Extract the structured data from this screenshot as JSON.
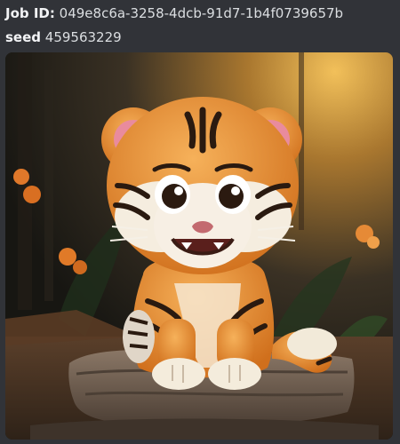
{
  "message": {
    "job_label": "Job ID:",
    "job_id": "049e8c6a-3258-4dcb-91d7-1b4f0739657b",
    "seed_label": "seed",
    "seed_value": "459563229"
  },
  "image": {
    "subject": "cartoon-tiger-cub-on-rock",
    "accent_colors": {
      "fur": "#e88a2a",
      "stripes": "#2a1a10",
      "background_glow": "#d49a3a",
      "rock": "#6b5b4c"
    }
  }
}
